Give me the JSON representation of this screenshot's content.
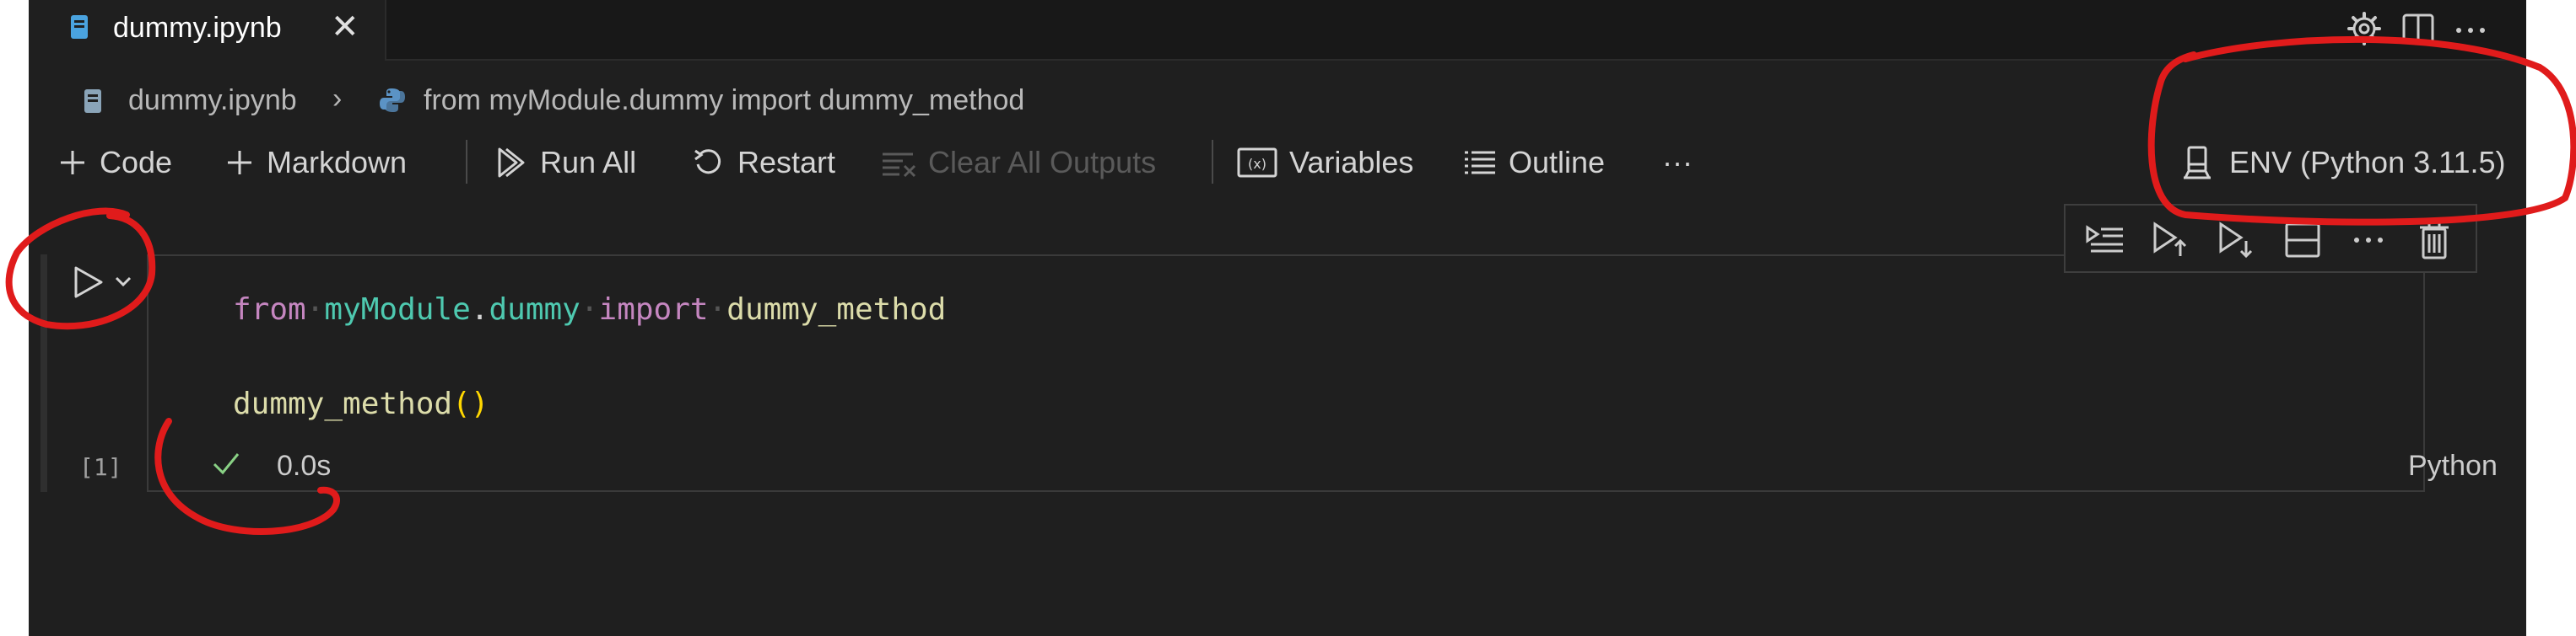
{
  "tab": {
    "title": "dummy.ipynb",
    "close": "✕"
  },
  "titlebar_icons": [
    "gear-icon",
    "split-editor-icon",
    "more-icon"
  ],
  "breadcrumb": {
    "file": "dummy.ipynb",
    "separator": "›",
    "symbol": "from myModule.dummy import dummy_method"
  },
  "toolbar": {
    "code": "Code",
    "markdown": "Markdown",
    "run_all": "Run All",
    "restart": "Restart",
    "clear_outputs": "Clear All Outputs",
    "variables": "Variables",
    "outline": "Outline",
    "more": "···",
    "kernel": "ENV (Python 3.11.5)"
  },
  "cell": {
    "line1": {
      "from": "from",
      "module1": "myModule",
      "dot": ".",
      "module2": "dummy",
      "import": "import",
      "name": "dummy_method"
    },
    "line3": {
      "call": "dummy_method",
      "parens": "()"
    },
    "execution_count": "[1]",
    "status_time": "0.0s",
    "language": "Python"
  },
  "colors": {
    "editor_bg": "#1f1f1f",
    "keyword": "#c586c0",
    "module": "#4ec9b0",
    "function": "#dcdcaa",
    "success": "#89d185",
    "annotation": "#e01b1b"
  }
}
